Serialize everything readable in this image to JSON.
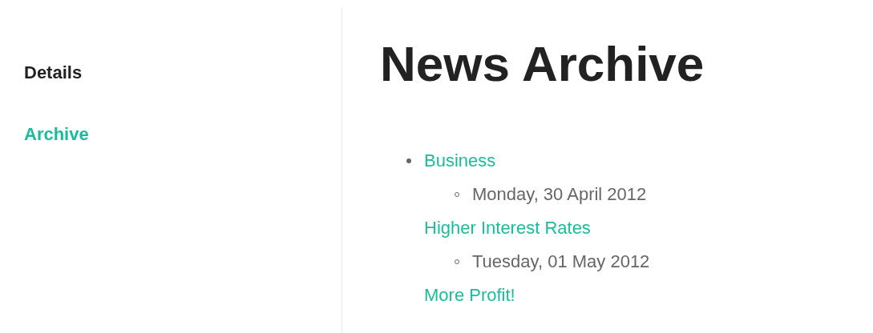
{
  "sidebar": {
    "items": [
      {
        "label": "Details",
        "selected": false
      },
      {
        "label": "Archive",
        "selected": true
      }
    ]
  },
  "main": {
    "title": "News Archive",
    "categories": [
      {
        "name": "Business",
        "entries": [
          {
            "date": "Monday, 30 April 2012",
            "headline": "Higher Interest Rates"
          },
          {
            "date": "Tuesday, 01 May 2012",
            "headline": "More Profit!"
          }
        ]
      }
    ]
  }
}
